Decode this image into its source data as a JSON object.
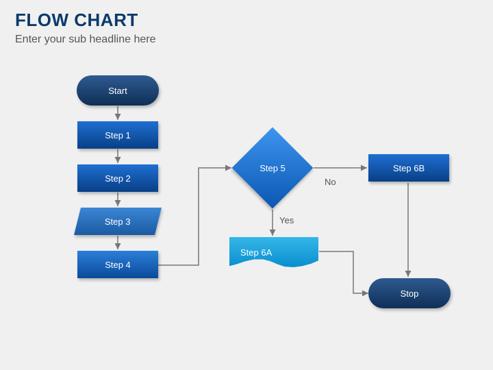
{
  "header": {
    "title": "Flow Chart",
    "subtitle": "Enter your sub headline here"
  },
  "nodes": {
    "start": "Start",
    "step1": "Step 1",
    "step2": "Step 2",
    "step3": "Step 3",
    "step4": "Step 4",
    "step5": "Step 5",
    "step6a": "Step 6A",
    "step6b": "Step 6B",
    "stop": "Stop"
  },
  "edges": {
    "yes": "Yes",
    "no": "No"
  }
}
